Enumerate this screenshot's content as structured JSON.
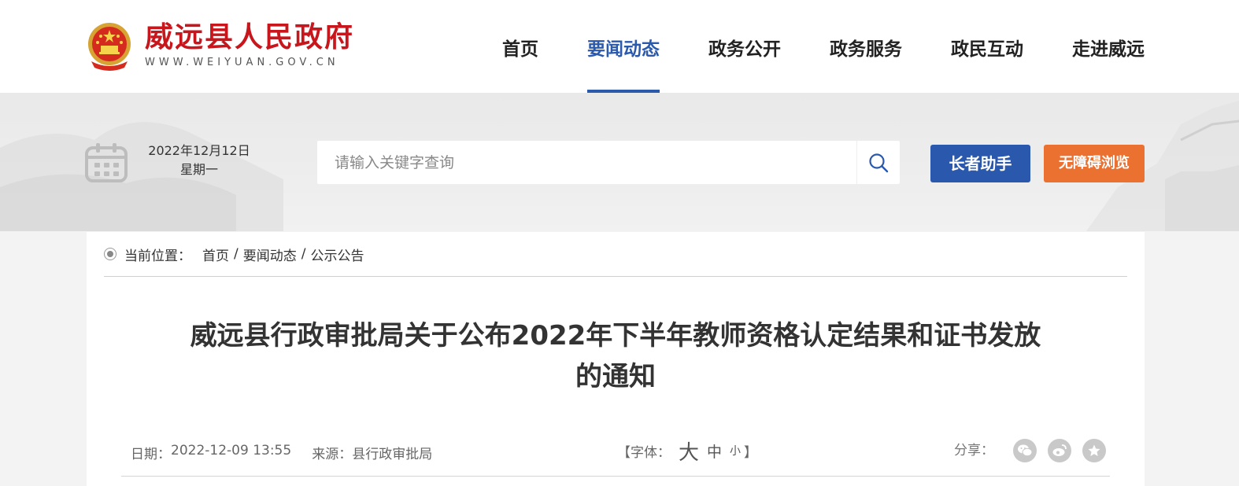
{
  "site": {
    "title": "威远县人民政府",
    "url_text": "WWW.WEIYUAN.GOV.CN"
  },
  "nav": {
    "items": [
      {
        "label": "首页",
        "active": false
      },
      {
        "label": "要闻动态",
        "active": true
      },
      {
        "label": "政务公开",
        "active": false
      },
      {
        "label": "政务服务",
        "active": false
      },
      {
        "label": "政民互动",
        "active": false
      },
      {
        "label": "走进威远",
        "active": false
      }
    ]
  },
  "date": {
    "date_text": "2022年12月12日",
    "weekday": "星期一"
  },
  "search": {
    "placeholder": "请输入关键字查询",
    "value": ""
  },
  "buttons": {
    "elder_label": "长者助手",
    "accessibility_label": "无障碍浏览"
  },
  "breadcrumb": {
    "label": "当前位置：",
    "items": [
      "首页",
      "要闻动态",
      "公示公告"
    ],
    "separator": "/"
  },
  "article": {
    "title_line1": "威远县行政审批局关于公布2022年下半年教师资格认定结果和证书发放",
    "title_line2": "的通知",
    "date_label": "日期：",
    "date_value": "2022-12-09 13:55",
    "source_label": "来源：",
    "source_value": "县行政审批局"
  },
  "font_size": {
    "open_label": "【字体：",
    "large": "大",
    "medium": "中",
    "small": "小",
    "close_label": "】"
  },
  "share": {
    "label": "分享：",
    "icons": [
      "wechat-icon",
      "weibo-icon",
      "favorite-icon"
    ]
  },
  "colors": {
    "brand_red": "#c8161d",
    "nav_active": "#2b59ac",
    "elder_button": "#2a58ad",
    "accessibility_button": "#ea7130"
  }
}
